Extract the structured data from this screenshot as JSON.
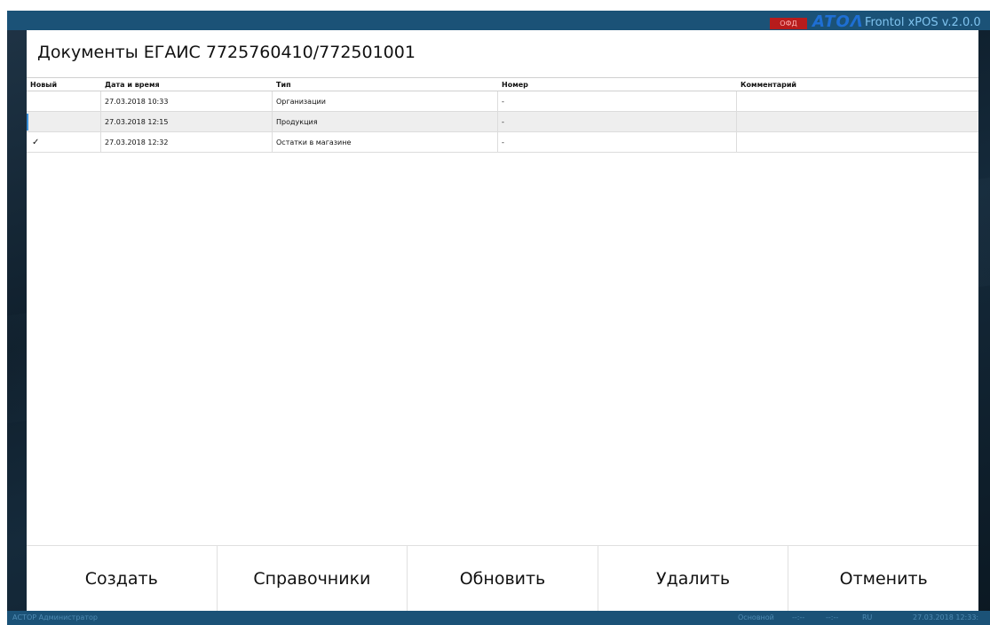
{
  "brand": {
    "ofd_badge": "ОФД",
    "logo_text": "ATOΛ",
    "app_title": "Frontol xPOS v.2.0.0"
  },
  "page": {
    "title": "Документы ЕГАИС 7725760410/772501001"
  },
  "table": {
    "headers": [
      "Новый",
      "Дата и время",
      "Тип",
      "Номер",
      "Комментарий"
    ],
    "rows": [
      {
        "new": "",
        "datetime": "27.03.2018 10:33",
        "type": "Организации",
        "number": "-",
        "comment": ""
      },
      {
        "new": "",
        "datetime": "27.03.2018 12:15",
        "type": "Продукция",
        "number": "-",
        "comment": ""
      },
      {
        "new": "✓",
        "datetime": "27.03.2018 12:32",
        "type": "Остатки в магазине",
        "number": "-",
        "comment": ""
      }
    ]
  },
  "buttons": {
    "create": "Создать",
    "references": "Справочники",
    "refresh": "Обновить",
    "delete": "Удалить",
    "cancel": "Отменить"
  },
  "status": {
    "user": "АСТОР  Администратор",
    "mode": "Основной",
    "indicator1": "--:--",
    "indicator2": "--:--",
    "lang": "RU",
    "datetime": "27.03.2018 12:33:"
  },
  "colors": {
    "accent": "#1b5277",
    "badge": "#b71c1c",
    "logo": "#1e6fd4",
    "selection": "#3a8fd8"
  },
  "icons": {
    "check": "check-icon"
  }
}
